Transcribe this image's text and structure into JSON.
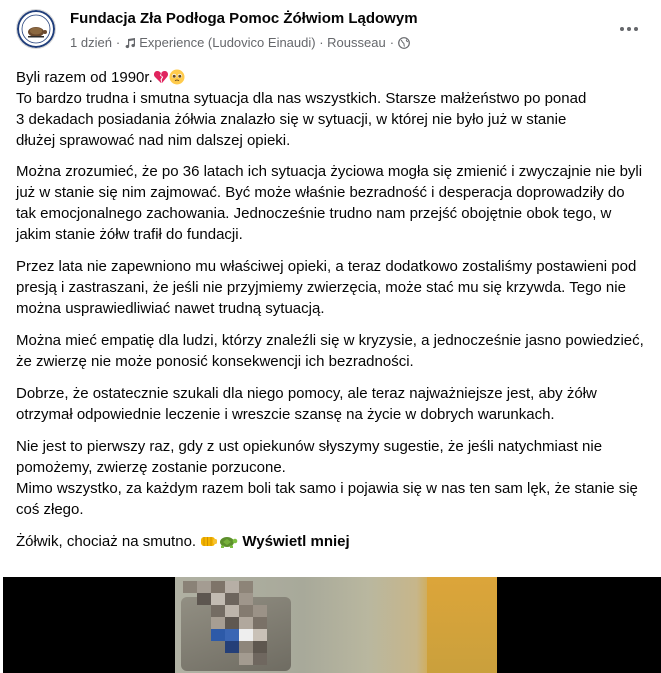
{
  "post": {
    "page_name": "Fundacja Zła Podłoga Pomoc Żółwiom Lądowym",
    "time": "1 dzień",
    "music": "Experience (Ludovico Einaudi) · Rousseau",
    "more_icon": "more-horizontal-icon",
    "privacy_icon": "globe-icon",
    "paragraphs": [
      {
        "lines": [
          "Byli razem od 1990r."
        ],
        "emoji": [
          "broken-heart-emoji",
          "pleading-face-emoji"
        ]
      },
      {
        "lines": [
          "To bardzo trudna i smutna sytuacja dla nas wszystkich. Starsze małżeństwo po ponad",
          "3 dekadach posiadania żółwia znalazło się w sytuacji, w której nie było już w stanie",
          "dłużej sprawować nad nim dalszej opieki."
        ]
      }
    ],
    "p2": "Można zrozumieć, że po 36 latach ich sytuacja życiowa mogła się zmienić i zwyczajnie nie byli już w stanie się nim zajmować. Być może właśnie bezradność i desperacja doprowadziły do tak emocjonalnego zachowania. Jednocześnie trudno nam przejść obojętnie obok tego, w jakim stanie żółw trafił do fundacji.",
    "p3": "Przez lata nie zapewniono mu właściwej opieki, a teraz dodatkowo zostaliśmy postawieni pod presją i zastraszani, że jeśli nie przyjmiemy zwierzęcia, może stać mu się krzywda. Tego nie można usprawiedliwiać nawet trudną sytuacją.",
    "p4": "Można mieć empatię dla ludzi, którzy znaleźli się w kryzysie, a jednocześnie jasno powiedzieć, że zwierzę nie może ponosić konsekwencji ich bezradności.",
    "p5": "Dobrze, że ostatecznie szukali dla niego pomocy, ale teraz najważniejsze jest, aby żółw otrzymał odpowiednie leczenie i wreszcie szansę na życie w dobrych warunkach.",
    "p6a": "Nie jest to pierwszy raz, gdy z ust opiekunów słyszymy sugestie, że jeśli natychmiast nie pomożemy, zwierzę zostanie porzucone.",
    "p6b": "Mimo wszystko, za każdym razem boli tak samo i pojawia się w nas ten sam lęk, że stanie się coś złego.",
    "p7": "Żółwik, chociaż na smutno.",
    "p7_emoji": [
      "fist-bump-emoji",
      "turtle-emoji"
    ],
    "see_less": "Wyświetl mniej"
  }
}
